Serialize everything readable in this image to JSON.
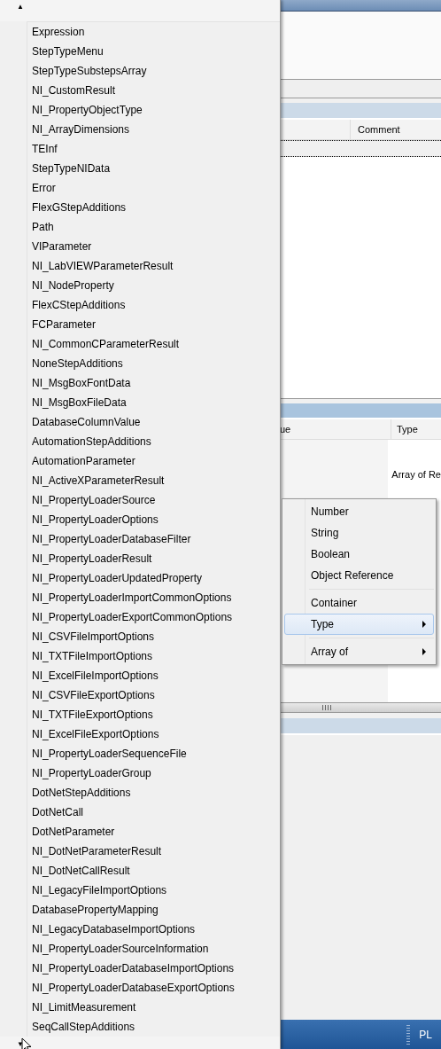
{
  "background_window": {
    "upper_table": {
      "columns": [
        {
          "label": "Comment"
        }
      ]
    },
    "lower_table": {
      "columns": [
        {
          "label": "ue"
        },
        {
          "label": "Type"
        }
      ],
      "cell": "Array of Re"
    },
    "taskbar": {
      "language": "PL"
    }
  },
  "type_list": {
    "scroll_up": "▲",
    "scroll_down": "▼",
    "items": [
      "Expression",
      "StepTypeMenu",
      "StepTypeSubstepsArray",
      "NI_CustomResult",
      "NI_PropertyObjectType",
      "NI_ArrayDimensions",
      "TEInf",
      "StepTypeNIData",
      "Error",
      "FlexGStepAdditions",
      "Path",
      "VIParameter",
      "NI_LabVIEWParameterResult",
      "NI_NodeProperty",
      "FlexCStepAdditions",
      "FCParameter",
      "NI_CommonCParameterResult",
      "NoneStepAdditions",
      "NI_MsgBoxFontData",
      "NI_MsgBoxFileData",
      "DatabaseColumnValue",
      "AutomationStepAdditions",
      "AutomationParameter",
      "NI_ActiveXParameterResult",
      "NI_PropertyLoaderSource",
      "NI_PropertyLoaderOptions",
      "NI_PropertyLoaderDatabaseFilter",
      "NI_PropertyLoaderResult",
      "NI_PropertyLoaderUpdatedProperty",
      "NI_PropertyLoaderImportCommonOptions",
      "NI_PropertyLoaderExportCommonOptions",
      "NI_CSVFileImportOptions",
      "NI_TXTFileImportOptions",
      "NI_ExcelFileImportOptions",
      "NI_CSVFileExportOptions",
      "NI_TXTFileExportOptions",
      "NI_ExcelFileExportOptions",
      "NI_PropertyLoaderSequenceFile",
      "NI_PropertyLoaderGroup",
      "DotNetStepAdditions",
      "DotNetCall",
      "DotNetParameter",
      "NI_DotNetParameterResult",
      "NI_DotNetCallResult",
      "NI_LegacyFileImportOptions",
      "DatabasePropertyMapping",
      "NI_LegacyDatabaseImportOptions",
      "NI_PropertyLoaderSourceInformation",
      "NI_PropertyLoaderDatabaseImportOptions",
      "NI_PropertyLoaderDatabaseExportOptions",
      "NI_LimitMeasurement",
      "SeqCallStepAdditions"
    ]
  },
  "context_menu": {
    "items": [
      {
        "kind": "item",
        "label": "Number",
        "selected": false,
        "submenu": false
      },
      {
        "kind": "item",
        "label": "String",
        "selected": false,
        "submenu": false
      },
      {
        "kind": "item",
        "label": "Boolean",
        "selected": false,
        "submenu": false
      },
      {
        "kind": "item",
        "label": "Object Reference",
        "selected": false,
        "submenu": false
      },
      {
        "kind": "separator"
      },
      {
        "kind": "item",
        "label": "Container",
        "selected": false,
        "submenu": false
      },
      {
        "kind": "item",
        "label": "Type",
        "selected": true,
        "submenu": true
      },
      {
        "kind": "separator"
      },
      {
        "kind": "item",
        "label": "Array of",
        "selected": false,
        "submenu": true
      }
    ]
  }
}
